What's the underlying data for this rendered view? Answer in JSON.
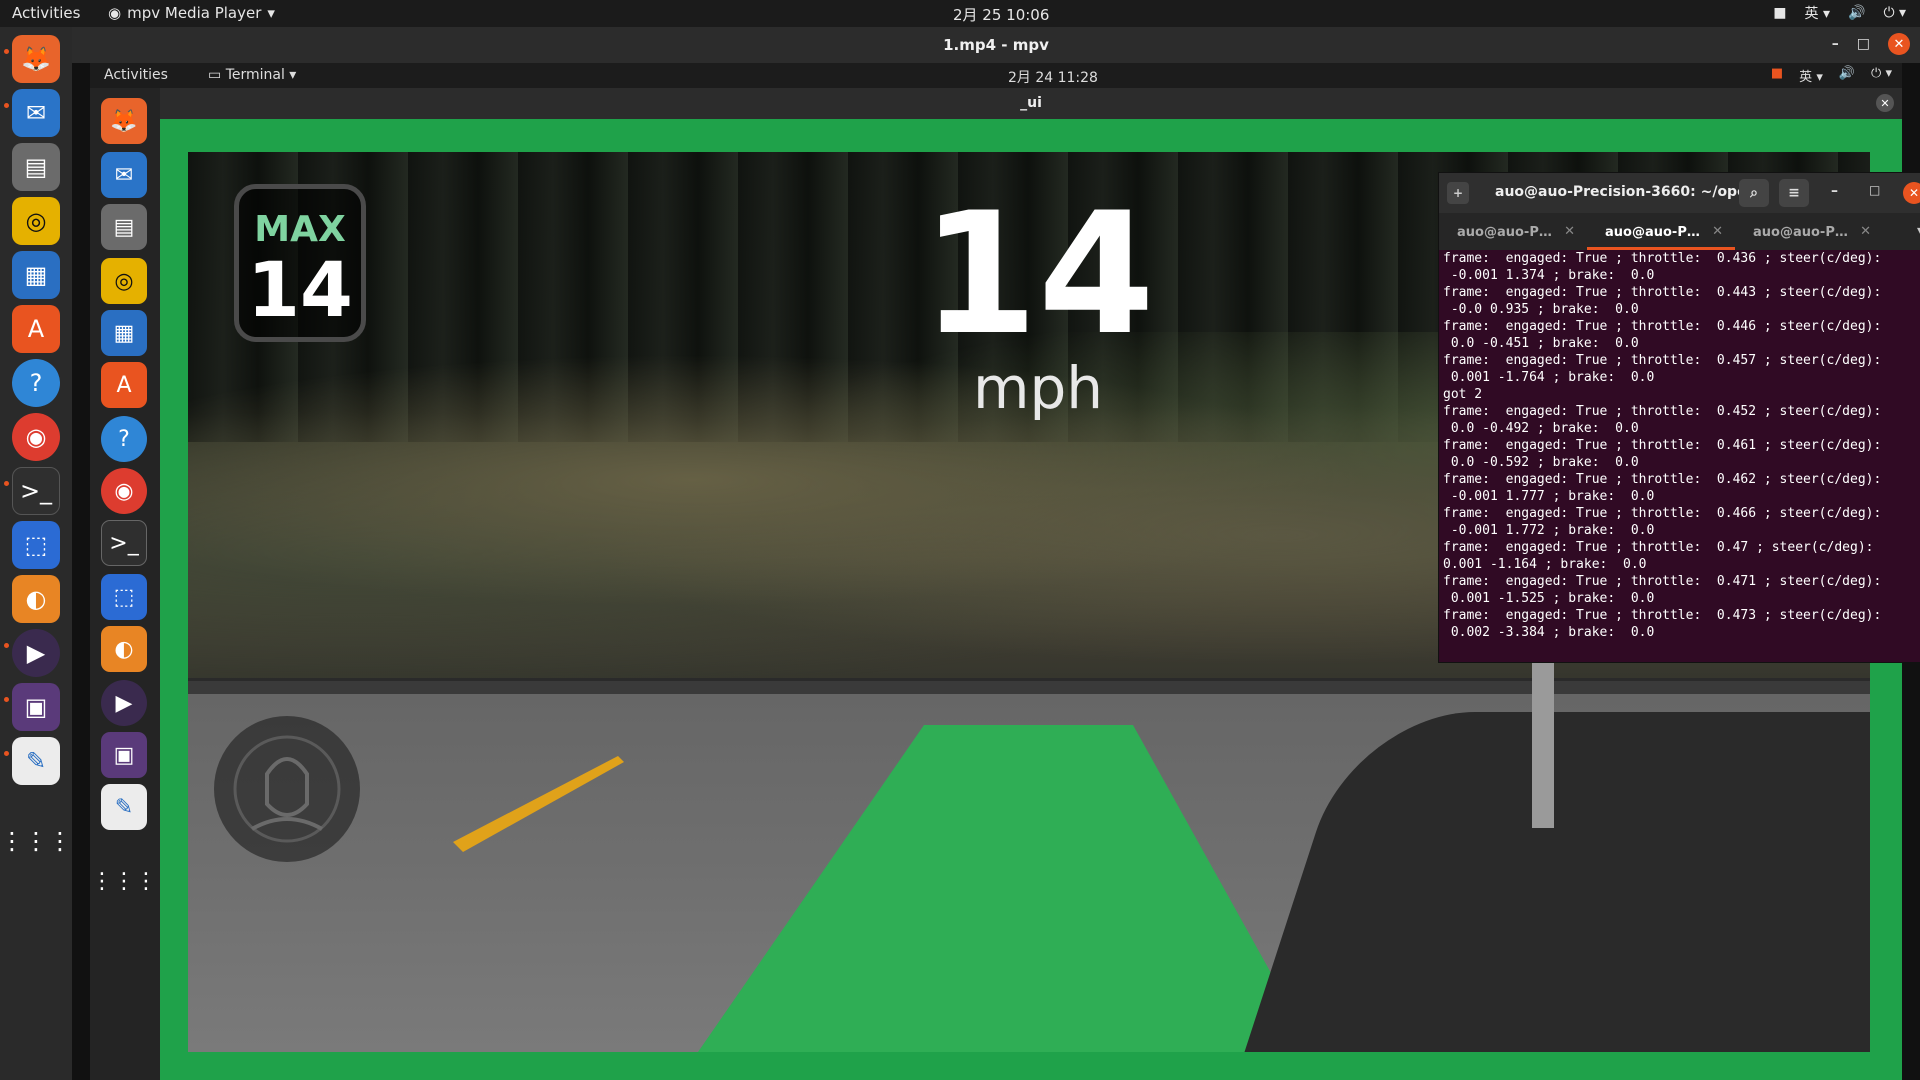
{
  "outer_topbar": {
    "activities": "Activities",
    "app_name": "mpv Media Player",
    "clock": "2月 25  10:06",
    "input_method": "英"
  },
  "mpv_window": {
    "title": "1.mp4 - mpv"
  },
  "inner_topbar": {
    "activities": "Activities",
    "app_name": "Terminal",
    "clock": "2月 24  11:28",
    "input_method": "英"
  },
  "ui_window": {
    "title": "_ui"
  },
  "hud": {
    "max_label": "MAX",
    "max_value": "14",
    "speed": "14",
    "speed_unit": "mph"
  },
  "terminal": {
    "title": "auo@auo-Precision-3660: ~/ope…",
    "tabs": [
      {
        "label": "auo@auo-P…",
        "active": false
      },
      {
        "label": "auo@auo-P…",
        "active": true
      },
      {
        "label": "auo@auo-P…",
        "active": false
      }
    ],
    "lines": [
      "frame:  engaged: True ; throttle:  0.436 ; steer(c/deg):",
      " -0.001 1.374 ; brake:  0.0",
      "frame:  engaged: True ; throttle:  0.443 ; steer(c/deg):",
      " -0.0 0.935 ; brake:  0.0",
      "frame:  engaged: True ; throttle:  0.446 ; steer(c/deg):",
      " 0.0 -0.451 ; brake:  0.0",
      "frame:  engaged: True ; throttle:  0.457 ; steer(c/deg):",
      " 0.001 -1.764 ; brake:  0.0",
      "got 2",
      "frame:  engaged: True ; throttle:  0.452 ; steer(c/deg):",
      " 0.0 -0.492 ; brake:  0.0",
      "frame:  engaged: True ; throttle:  0.461 ; steer(c/deg):",
      " 0.0 -0.592 ; brake:  0.0",
      "frame:  engaged: True ; throttle:  0.462 ; steer(c/deg):",
      " -0.001 1.777 ; brake:  0.0",
      "frame:  engaged: True ; throttle:  0.466 ; steer(c/deg):",
      " -0.001 1.772 ; brake:  0.0",
      "frame:  engaged: True ; throttle:  0.47 ; steer(c/deg):",
      "0.001 -1.164 ; brake:  0.0",
      "frame:  engaged: True ; throttle:  0.471 ; steer(c/deg):",
      " 0.001 -1.525 ; brake:  0.0",
      "frame:  engaged: True ; throttle:  0.473 ; steer(c/deg):",
      " 0.002 -3.384 ; brake:  0.0"
    ]
  },
  "dock_icons": [
    "firefox-icon",
    "thunderbird-icon",
    "files-icon",
    "rhythmbox-icon",
    "writer-icon",
    "software-icon",
    "help-icon",
    "chrome-icon",
    "terminal-icon",
    "screenshot-icon",
    "blender-icon",
    "media-player-icon",
    "video-editor-icon",
    "text-editor-icon",
    "app-grid-icon"
  ],
  "colors": {
    "accent": "#e95420",
    "lane_green": "#1fa24a",
    "max_label_green": "#7fd3a0",
    "terminal_bg": "#300a24"
  }
}
